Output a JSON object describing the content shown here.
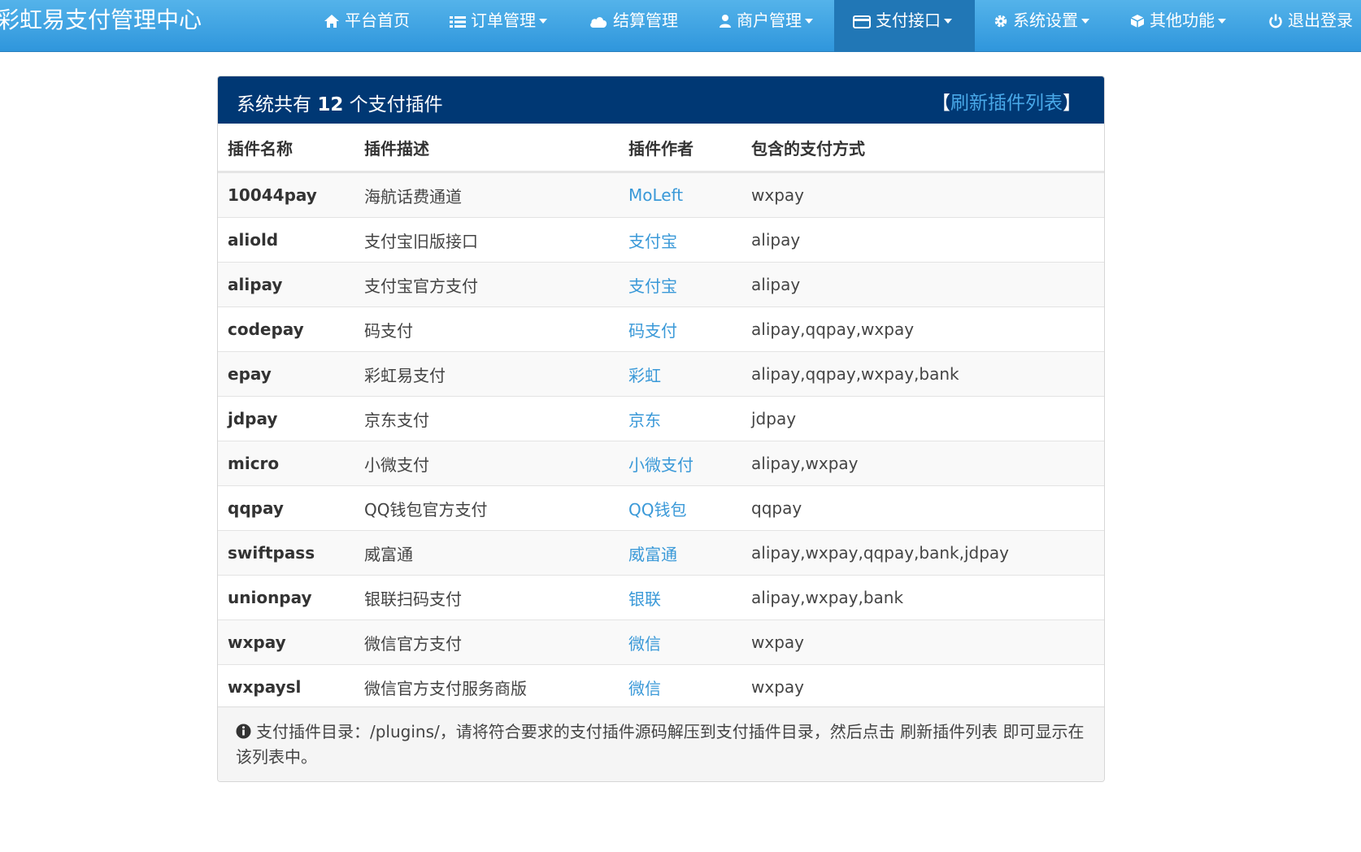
{
  "navbar": {
    "brand": "彩虹易支付管理中心",
    "items": [
      {
        "label": "平台首页",
        "icon": "home-icon",
        "dropdown": false
      },
      {
        "label": "订单管理",
        "icon": "list-icon",
        "dropdown": true
      },
      {
        "label": "结算管理",
        "icon": "cloud-icon",
        "dropdown": false
      },
      {
        "label": "商户管理",
        "icon": "user-icon",
        "dropdown": true
      },
      {
        "label": "支付接口",
        "icon": "credit-card-icon",
        "dropdown": true,
        "active": true
      },
      {
        "label": "系统设置",
        "icon": "gear-icon",
        "dropdown": true
      },
      {
        "label": "其他功能",
        "icon": "cube-icon",
        "dropdown": true
      },
      {
        "label": "退出登录",
        "icon": "power-icon",
        "dropdown": false
      }
    ]
  },
  "panel": {
    "title_prefix": "系统共有",
    "count": "12",
    "title_suffix": "个支付插件",
    "refresh_open": "【",
    "refresh_label": "刷新插件列表",
    "refresh_close": "】"
  },
  "table": {
    "headers": [
      "插件名称",
      "插件描述",
      "插件作者",
      "包含的支付方式"
    ],
    "rows": [
      {
        "name": "10044pay",
        "desc": "海航话费通道",
        "author": "MoLeft",
        "methods": "wxpay"
      },
      {
        "name": "aliold",
        "desc": "支付宝旧版接口",
        "author": "支付宝",
        "methods": "alipay"
      },
      {
        "name": "alipay",
        "desc": "支付宝官方支付",
        "author": "支付宝",
        "methods": "alipay"
      },
      {
        "name": "codepay",
        "desc": "码支付",
        "author": "码支付",
        "methods": "alipay,qqpay,wxpay"
      },
      {
        "name": "epay",
        "desc": "彩虹易支付",
        "author": "彩虹",
        "methods": "alipay,qqpay,wxpay,bank"
      },
      {
        "name": "jdpay",
        "desc": "京东支付",
        "author": "京东",
        "methods": "jdpay"
      },
      {
        "name": "micro",
        "desc": "小微支付",
        "author": "小微支付",
        "methods": "alipay,wxpay"
      },
      {
        "name": "qqpay",
        "desc": "QQ钱包官方支付",
        "author": "QQ钱包",
        "methods": "qqpay"
      },
      {
        "name": "swiftpass",
        "desc": "威富通",
        "author": "威富通",
        "methods": "alipay,wxpay,qqpay,bank,jdpay"
      },
      {
        "name": "unionpay",
        "desc": "银联扫码支付",
        "author": "银联",
        "methods": "alipay,wxpay,bank"
      },
      {
        "name": "wxpay",
        "desc": "微信官方支付",
        "author": "微信",
        "methods": "wxpay"
      },
      {
        "name": "wxpaysl",
        "desc": "微信官方支付服务商版",
        "author": "微信",
        "methods": "wxpay"
      }
    ]
  },
  "footer": {
    "icon": "info-circle-icon",
    "text": "支付插件目录：/plugins/，请将符合要求的支付插件源码解压到支付插件目录，然后点击 刷新插件列表 即可显示在该列表中。"
  },
  "colors": {
    "navbar_top": "#54b3ea",
    "navbar_bottom": "#2f96dc",
    "nav_active": "#2177b6",
    "panel_heading": "#003874",
    "link": "#3a99d8"
  }
}
